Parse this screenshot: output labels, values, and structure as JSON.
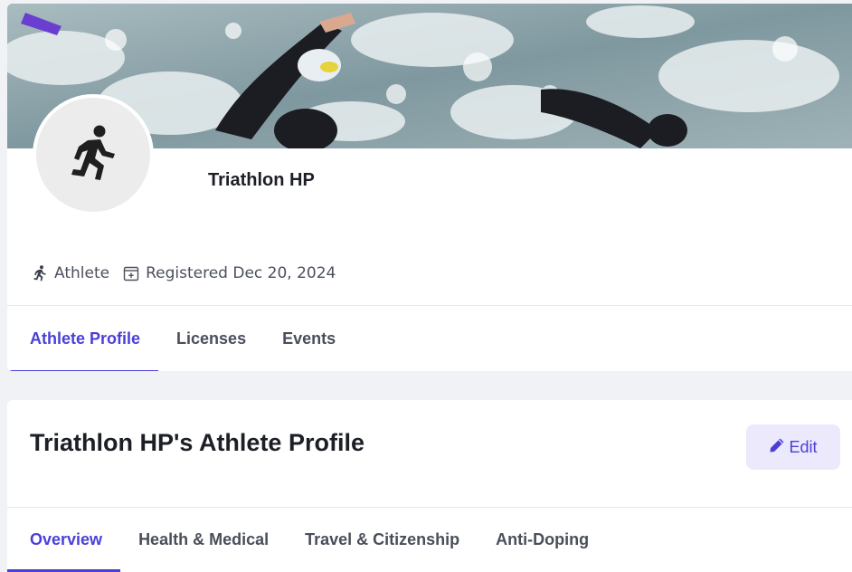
{
  "profile": {
    "name": "Triathlon HP",
    "avatar_icon": "running-person-icon",
    "banner_image": "triathlon-swimmers-banner"
  },
  "meta": {
    "role": "Athlete",
    "role_icon": "running-person-icon",
    "registered": "Registered Dec 20, 2024",
    "registered_icon": "calendar-icon"
  },
  "top_tabs": [
    {
      "label": "Athlete Profile",
      "active": true
    },
    {
      "label": "Licenses",
      "active": false
    },
    {
      "label": "Events",
      "active": false
    }
  ],
  "section": {
    "title": "Triathlon HP's Athlete Profile",
    "edit_label": "Edit",
    "edit_icon": "pencil-icon"
  },
  "sub_tabs": [
    {
      "label": "Overview",
      "active": true
    },
    {
      "label": "Health & Medical",
      "active": false
    },
    {
      "label": "Travel & Citizenship",
      "active": false
    },
    {
      "label": "Anti-Doping",
      "active": false
    }
  ],
  "colors": {
    "accent": "#4a3fd8",
    "edit_bg": "#ebe9fb",
    "page_bg": "#f1f2f6"
  }
}
